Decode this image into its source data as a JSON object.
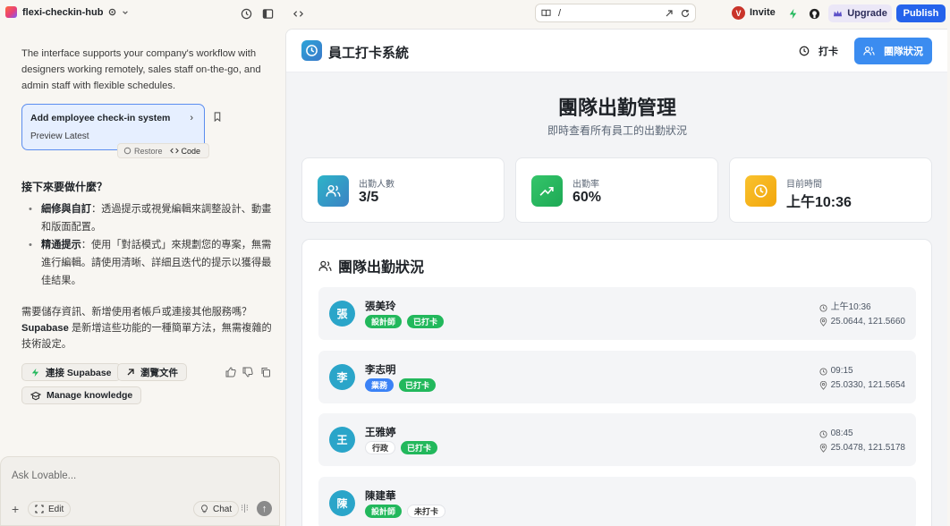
{
  "topbar": {
    "project_name": "flexi-checkin-hub",
    "url_path": "/",
    "avatar_initial": "V",
    "invite_label": "Invite",
    "upgrade_label": "Upgrade",
    "publish_label": "Publish"
  },
  "chat": {
    "intro": "The interface supports your company's workflow with designers working remotely, sales staff on-the-go, and admin staff with flexible schedules.",
    "version_card": {
      "title": "Add employee check-in system",
      "subtitle": "Preview Latest"
    },
    "restore_label": "Restore",
    "code_label": "Code",
    "next_heading": "接下來要做什麼？",
    "bullets": [
      {
        "bold": "細修與自訂",
        "text": "：透過提示或視覺編輯來調整設計、動畫和版面配置。"
      },
      {
        "bold": "精通提示",
        "text": "：使用「對話模式」來規劃您的專案，無需進行編輯。請使用清晰、詳細且迭代的提示以獲得最佳結果。"
      }
    ],
    "supabase_q": "需要儲存資訊、新增使用者帳戶或連接其他服務嗎？",
    "supabase_bold": "Supabase",
    "supabase_rest": " 是新增這些功能的一種簡單方法，無需複雜的技術設定。",
    "connect_supabase": "連接 Supabase",
    "browse_docs": "瀏覽文件",
    "manage_knowledge": "Manage knowledge",
    "input_placeholder": "Ask Lovable...",
    "edit_label": "Edit",
    "chat_label": "Chat"
  },
  "app": {
    "title": "員工打卡系統",
    "punch_label": "打卡",
    "status_label": "團隊狀況",
    "main_title": "團隊出勤管理",
    "main_subtitle": "即時查看所有員工的出勤狀況",
    "stats": [
      {
        "label": "出勤人數",
        "value": "3/5",
        "color": "#2ba6c4"
      },
      {
        "label": "出勤率",
        "value": "60%",
        "color": "#22b85c"
      },
      {
        "label": "目前時間",
        "value": "上午10:36",
        "color": "#f5b719"
      }
    ],
    "team_heading": "團隊出勤狀況",
    "members": [
      {
        "initial": "張",
        "name": "張美玲",
        "role": "設計師",
        "role_style": "role-green",
        "status": "已打卡",
        "status_style": "st-in",
        "time": "上午10:36",
        "coords": "25.0644, 121.5660"
      },
      {
        "initial": "李",
        "name": "李志明",
        "role": "業務",
        "role_style": "role-blue",
        "status": "已打卡",
        "status_style": "st-in",
        "time": "09:15",
        "coords": "25.0330, 121.5654"
      },
      {
        "initial": "王",
        "name": "王雅婷",
        "role": "行政",
        "role_style": "role-plain",
        "status": "已打卡",
        "status_style": "st-in",
        "time": "08:45",
        "coords": "25.0478, 121.5178"
      },
      {
        "initial": "陳",
        "name": "陳建華",
        "role": "設計師",
        "role_style": "role-green",
        "status": "未打卡",
        "status_style": "st-out",
        "time": "",
        "coords": ""
      }
    ]
  }
}
